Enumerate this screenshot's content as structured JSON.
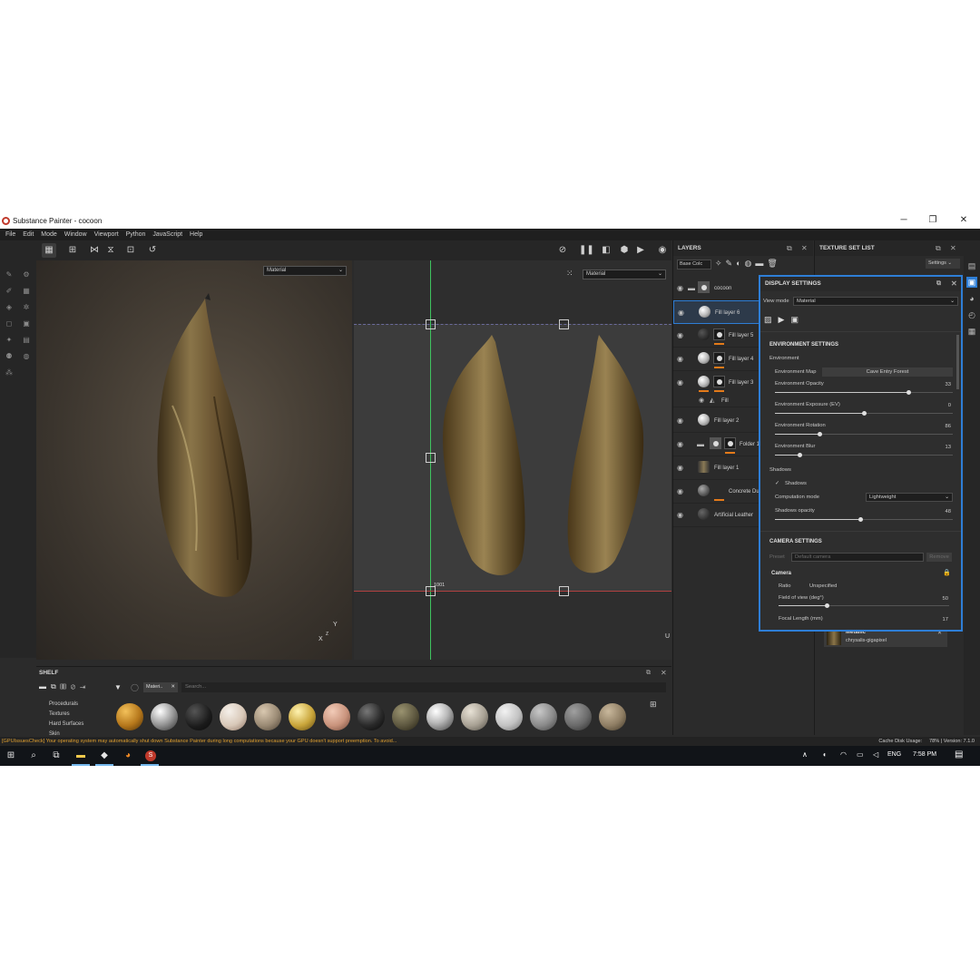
{
  "window": {
    "title": "Substance Painter - cocoon",
    "minimize": "─",
    "maximize": "❐",
    "close": "✕"
  },
  "menu": [
    "File",
    "Edit",
    "Mode",
    "Window",
    "Viewport",
    "Python",
    "JavaScript",
    "Help"
  ],
  "viewport3d": {
    "material_select": "Material",
    "axis_x": "X",
    "axis_y": "Y",
    "axis_z": "Z"
  },
  "viewport2d": {
    "material_select": "Material",
    "uv_tile": "1001",
    "axis_u": "U"
  },
  "layers": {
    "title": "LAYERS",
    "channel_select": "Base Colc",
    "items": [
      {
        "name": "cocoon",
        "kind": "folder"
      },
      {
        "name": "Fill layer 6",
        "kind": "fill",
        "selected": true
      },
      {
        "name": "Fill layer 5",
        "kind": "fill-mask"
      },
      {
        "name": "Fill layer 4",
        "kind": "fill-mask"
      },
      {
        "name": "Fill layer 3",
        "kind": "fill-mask",
        "sub": "Fill"
      },
      {
        "name": "Fill layer 2",
        "kind": "fill"
      },
      {
        "name": "Folder 1",
        "kind": "folder-mask"
      },
      {
        "name": "Fill layer 1",
        "kind": "fill"
      },
      {
        "name": "Concrete Du",
        "kind": "material"
      },
      {
        "name": "Artificial Leather",
        "kind": "material"
      }
    ]
  },
  "texture_set_list": {
    "title": "TEXTURE SET LIST",
    "settings_button": "Settings",
    "material_name": "Metallic",
    "texture_set": "chrysalis-gigapixel"
  },
  "display_settings": {
    "title": "DISPLAY SETTINGS",
    "view_mode_label": "View mode",
    "view_mode_value": "Material",
    "environment_settings_title": "ENVIRONMENT SETTINGS",
    "environment_label": "Environment",
    "environment_map_label": "Environment Map",
    "environment_map_value": "Cave Entry Forest",
    "sliders": [
      {
        "label": "Environment Opacity",
        "value": "33",
        "fraction": 0.75
      },
      {
        "label": "Environment Exposure (EV)",
        "value": "0",
        "fraction": 0.5
      },
      {
        "label": "Environment Rotation",
        "value": "86",
        "fraction": 0.25
      },
      {
        "label": "Environment Blur",
        "value": "13",
        "fraction": 0.14
      }
    ],
    "shadows_label": "Shadows",
    "shadows_check_label": "Shadows",
    "computation_mode_label": "Computation mode",
    "computation_mode_value": "Lightweight",
    "shadows_opacity_label": "Shadows opacity",
    "shadows_opacity_value": "48",
    "shadows_opacity_fraction": 0.48,
    "camera_settings_title": "CAMERA SETTINGS",
    "preset_label": "Preset",
    "preset_placeholder": "Default camera",
    "preset_button": "Remove",
    "camera_label": "Camera",
    "ratio_label": "Ratio",
    "ratio_value": "Unspecified",
    "fov_label": "Field of view (deg°)",
    "fov_value": "50",
    "fov_fraction": 0.28,
    "focal_label": "Focal Length (mm)",
    "focal_value": "17"
  },
  "shelf": {
    "title": "SHELF",
    "filter_tag": "Materi..",
    "search_placeholder": "Search...",
    "categories": [
      "Procedurals",
      "Textures",
      "Hard Surfaces",
      "Skin"
    ]
  },
  "status": {
    "warning": "[GPUIssuesCheck] Your operating system may automatically shut down Substance Painter during long computations because your GPU doesn't support preemption. To avoid...",
    "cache": "Cache Disk Usage:",
    "cache_value": "78%",
    "version": "| Version: 7.1.0"
  },
  "taskbar": {
    "language": "ENG",
    "time": "7:58 PM"
  },
  "colors": {
    "accent": "#2e7ed6",
    "orange": "#e37a1a",
    "warning": "#e0a030"
  }
}
